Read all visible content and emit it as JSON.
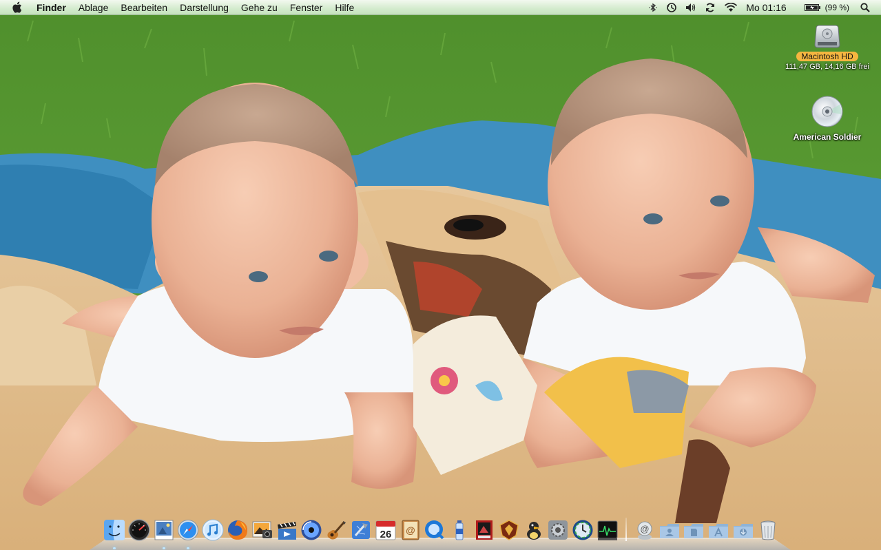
{
  "menubar": {
    "app_name": "Finder",
    "menus": [
      "Ablage",
      "Bearbeiten",
      "Darstellung",
      "Gehe zu",
      "Fenster",
      "Hilfe"
    ],
    "status_icons": [
      "bluetooth-icon",
      "time-machine-icon",
      "volume-icon",
      "sync-icon",
      "wifi-icon"
    ],
    "clock": "Mo 01:16",
    "battery": "(99 %)"
  },
  "desktop": {
    "drive": {
      "name": "Macintosh HD",
      "info": "111,47 GB, 14,16 GB frei"
    },
    "disc": {
      "name": "American Soldier"
    }
  },
  "dock": {
    "apps": [
      {
        "name": "Finder",
        "icon": "finder-icon",
        "running": true
      },
      {
        "name": "Dashboard",
        "icon": "dashboard-icon",
        "running": false
      },
      {
        "name": "Vorschau",
        "icon": "preview-icon",
        "running": true
      },
      {
        "name": "Safari",
        "icon": "safari-icon",
        "running": true
      },
      {
        "name": "iTunes",
        "icon": "itunes-icon",
        "running": false
      },
      {
        "name": "Firefox",
        "icon": "firefox-icon",
        "running": false
      },
      {
        "name": "iPhoto",
        "icon": "iphoto-icon",
        "running": false
      },
      {
        "name": "iMovie",
        "icon": "imovie-icon",
        "running": false
      },
      {
        "name": "iDVD",
        "icon": "idvd-icon",
        "running": false
      },
      {
        "name": "GarageBand",
        "icon": "garageband-icon",
        "running": false
      },
      {
        "name": "Xcode",
        "icon": "xcode-icon",
        "running": false
      },
      {
        "name": "iCal",
        "icon": "ical-icon",
        "date": "26",
        "running": false
      },
      {
        "name": "Adressbuch",
        "icon": "addressbook-icon",
        "running": false
      },
      {
        "name": "QuickTime",
        "icon": "quicktime-icon",
        "running": false
      },
      {
        "name": "Gelöscht",
        "icon": "bottle-icon",
        "running": false
      },
      {
        "name": "Photo Booth",
        "icon": "photobooth-icon",
        "running": false
      },
      {
        "name": "Sicherheitsprogramm",
        "icon": "shield-app-icon",
        "running": false
      },
      {
        "name": "Cyberduck",
        "icon": "duck-app-icon",
        "running": false
      },
      {
        "name": "Systemeinstellungen",
        "icon": "system-preferences-icon",
        "running": false
      },
      {
        "name": "Time Machine",
        "icon": "time-machine-app-icon",
        "running": false
      },
      {
        "name": "Aktivitätsanzeige",
        "icon": "activity-monitor-icon",
        "running": false
      }
    ],
    "stacks": [
      {
        "name": "Dienstprogramm",
        "icon": "utility-stack-icon"
      },
      {
        "name": "Benutzer",
        "icon": "user-folder-icon"
      },
      {
        "name": "Dokumente",
        "icon": "documents-folder-icon"
      },
      {
        "name": "Programme",
        "icon": "applications-folder-icon"
      },
      {
        "name": "Downloads",
        "icon": "downloads-folder-icon"
      },
      {
        "name": "Papierkorb",
        "icon": "trash-icon"
      }
    ]
  }
}
